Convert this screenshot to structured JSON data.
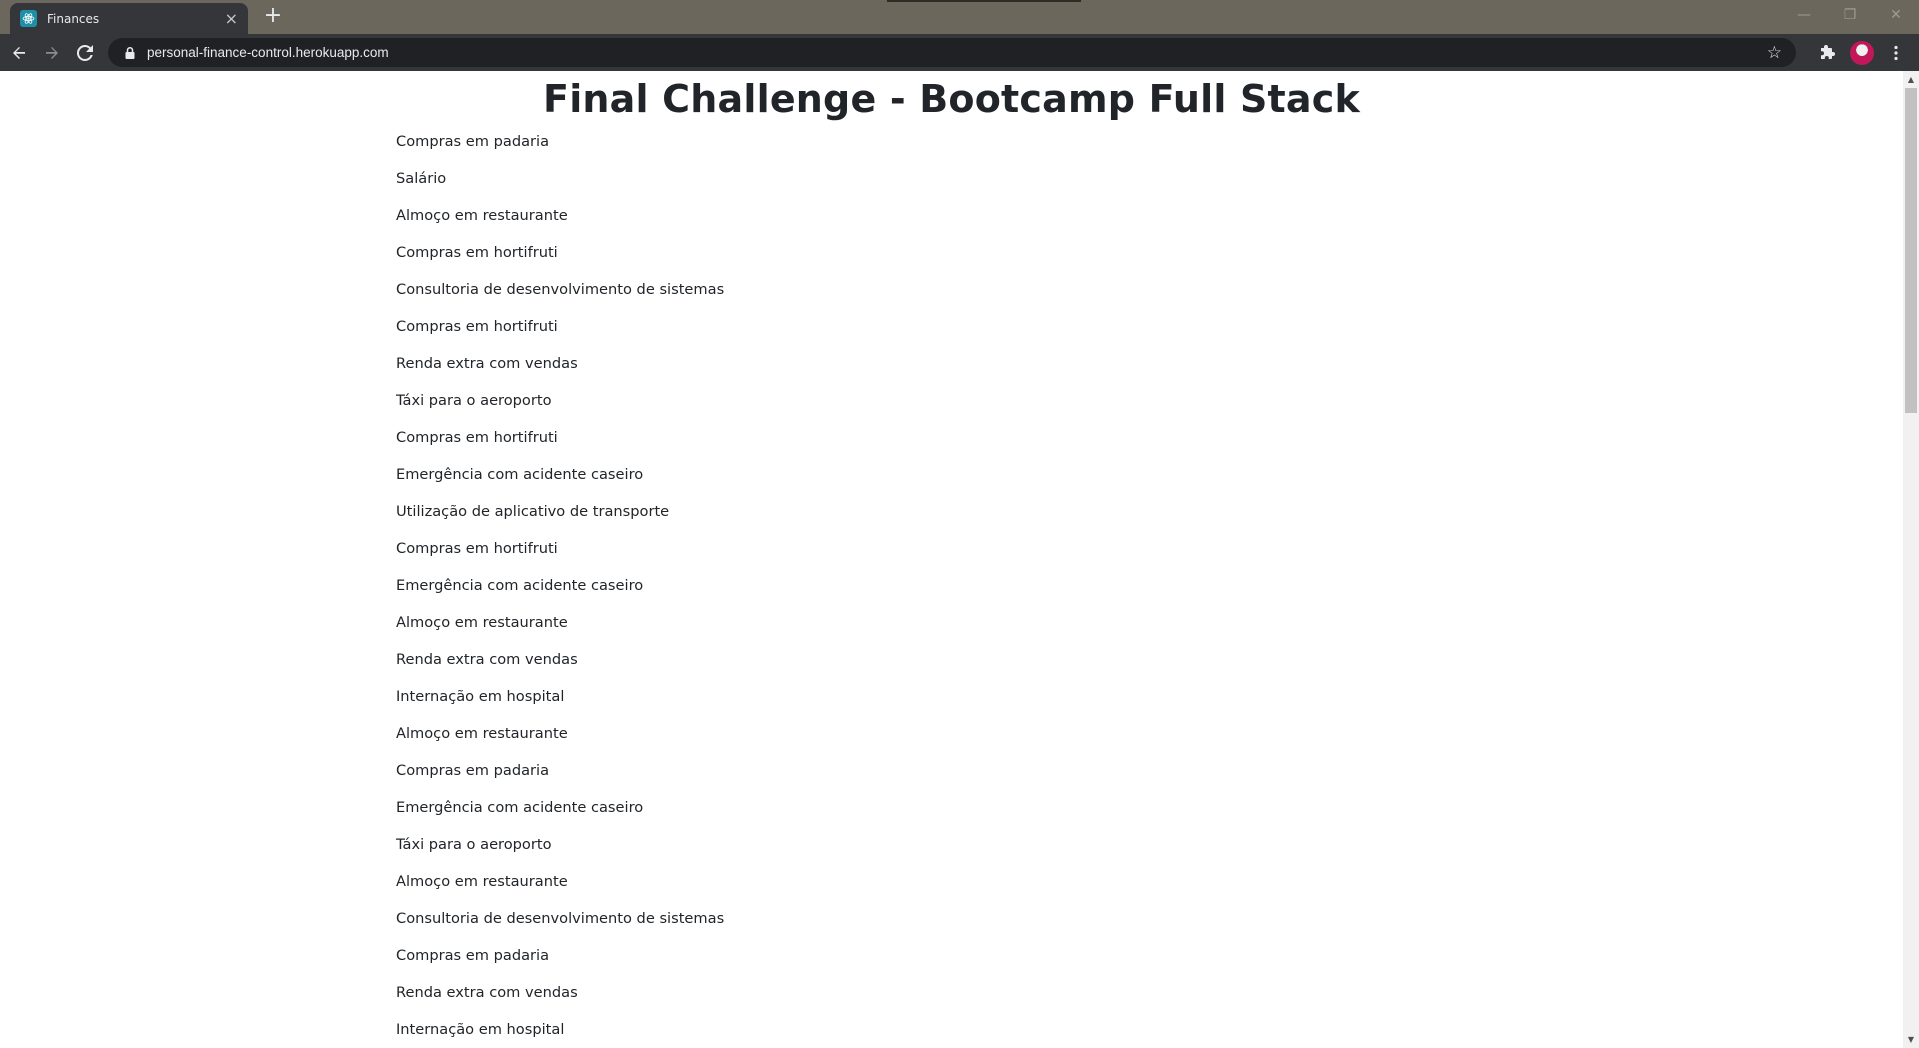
{
  "browser": {
    "tab": {
      "title": "Finances",
      "close_label": "×"
    },
    "new_tab_label": "+",
    "address_bar": {
      "url": "personal-finance-control.herokuapp.com"
    },
    "icons": {
      "favicon": "react-logo-icon",
      "back": "arrow-left-icon",
      "forward": "arrow-right-icon",
      "reload": "reload-icon",
      "lock": "lock-icon",
      "bookmark": "star-icon",
      "extensions": "puzzle-icon",
      "profile": "avatar",
      "menu": "kebab-menu-icon"
    },
    "window_controls": {
      "minimize": "—",
      "restore": "❐",
      "close": "✕"
    }
  },
  "page": {
    "title": "Final Challenge - Bootcamp Full Stack",
    "transactions": [
      "Compras em padaria",
      "Salário",
      "Almoço em restaurante",
      "Compras em hortifruti",
      "Consultoria de desenvolvimento de sistemas",
      "Compras em hortifruti",
      "Renda extra com vendas",
      "Táxi para o aeroporto",
      "Compras em hortifruti",
      "Emergência com acidente caseiro",
      "Utilização de aplicativo de transporte",
      "Compras em hortifruti",
      "Emergência com acidente caseiro",
      "Almoço em restaurante",
      "Renda extra com vendas",
      "Internação em hospital",
      "Almoço em restaurante",
      "Compras em padaria",
      "Emergência com acidente caseiro",
      "Táxi para o aeroporto",
      "Almoço em restaurante",
      "Consultoria de desenvolvimento de sistemas",
      "Compras em padaria",
      "Renda extra com vendas",
      "Internação em hospital"
    ]
  },
  "colors": {
    "tabstrip_bg": "#6b675c",
    "toolbar_bg": "#35363a",
    "omnibox_bg": "#202124",
    "page_text": "#212529"
  }
}
